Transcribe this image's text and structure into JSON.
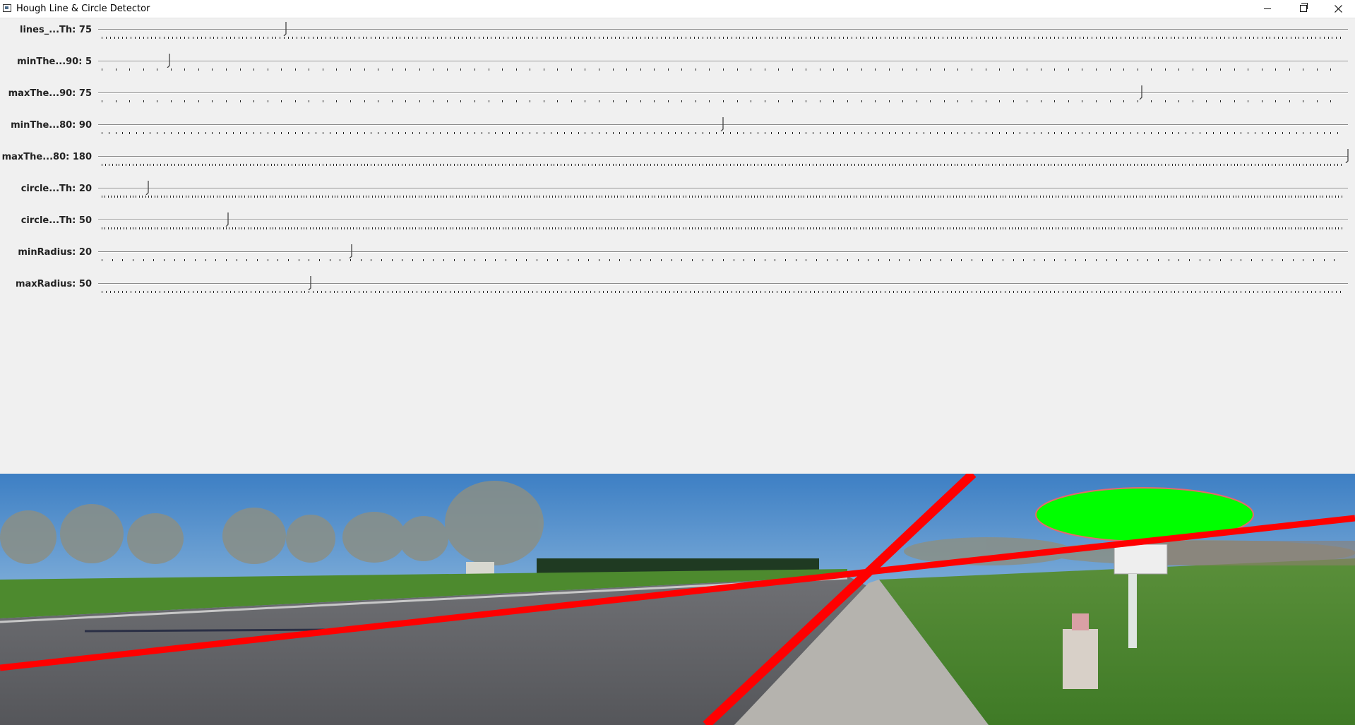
{
  "window": {
    "title": "Hough Line & Circle Detector",
    "icon": "app-window-icon",
    "controls": [
      "minimize-icon",
      "restore-icon",
      "close-icon"
    ]
  },
  "trackbars": [
    {
      "label": "lines_...Th: 75",
      "position": 0.15
    },
    {
      "label": "minThe...90: 5",
      "position": 0.057
    },
    {
      "label": "maxThe...90: 75",
      "position": 0.835
    },
    {
      "label": "minThe...80: 90",
      "position": 0.5
    },
    {
      "label": "maxThe...80: 180",
      "position": 1.0
    },
    {
      "label": "circle...Th: 20",
      "position": 0.04
    },
    {
      "label": "circle...Th: 50",
      "position": 0.104
    },
    {
      "label": "minRadius: 20",
      "position": 0.203
    },
    {
      "label": "maxRadius: 50",
      "position": 0.17
    }
  ],
  "image": {
    "description_icon": "road-scene-image",
    "overlay_colors": {
      "lines": "#ff0000",
      "circle": "#00ff00"
    }
  }
}
